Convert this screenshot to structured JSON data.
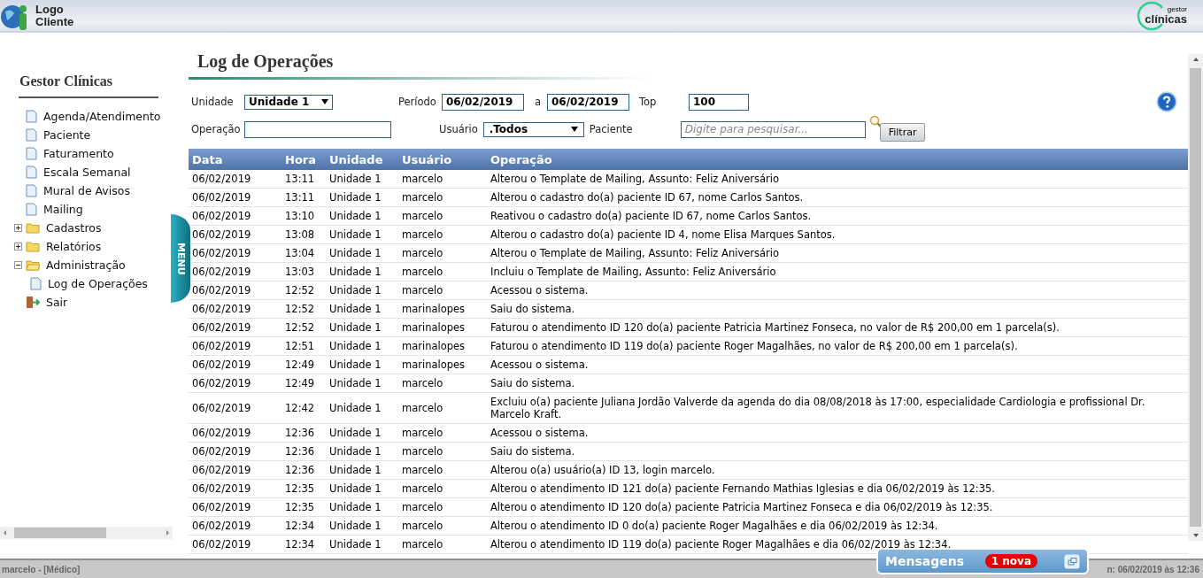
{
  "header": {
    "logo_text": [
      "Logo",
      "Cliente"
    ],
    "brand_small": "gestor",
    "brand": "clínicas"
  },
  "sidebar": {
    "title": "Gestor Clínicas",
    "items": [
      {
        "kind": "page",
        "label": "Agenda/Atendimento"
      },
      {
        "kind": "page",
        "label": "Paciente"
      },
      {
        "kind": "page",
        "label": "Faturamento"
      },
      {
        "kind": "page",
        "label": "Escala Semanal"
      },
      {
        "kind": "page",
        "label": "Mural de Avisos"
      },
      {
        "kind": "page",
        "label": "Mailing"
      },
      {
        "kind": "folder",
        "label": "Cadastros",
        "expanded": false
      },
      {
        "kind": "folder",
        "label": "Relatórios",
        "expanded": false
      },
      {
        "kind": "folder",
        "label": "Administração",
        "expanded": true,
        "children": [
          {
            "kind": "page",
            "label": "Log de Operações"
          }
        ]
      },
      {
        "kind": "exit",
        "label": "Sair"
      }
    ]
  },
  "menu_tab": "MENU",
  "page_title": "Log de Operações",
  "filters": {
    "unidade": {
      "label": "Unidade",
      "value": "Unidade 1"
    },
    "periodo": {
      "label": "Período",
      "from": "06/02/2019",
      "sep": "a",
      "to": "06/02/2019"
    },
    "top": {
      "label": "Top",
      "value": "100"
    },
    "operacao": {
      "label": "Operação"
    },
    "usuario": {
      "label": "Usuário",
      "value": ".Todos"
    },
    "paciente": {
      "label": "Paciente",
      "placeholder": "Digite para pesquisar..."
    },
    "button": "Filtrar"
  },
  "table": {
    "columns": [
      "Data",
      "Hora",
      "Unidade",
      "Usuário",
      "Operação"
    ],
    "rows": [
      [
        "06/02/2019",
        "13:11",
        "Unidade 1",
        "marcelo",
        "Alterou o Template de Mailing, Assunto: Feliz Aniversário"
      ],
      [
        "06/02/2019",
        "13:11",
        "Unidade 1",
        "marcelo",
        "Alterou o cadastro do(a) paciente ID 67, nome Carlos Santos."
      ],
      [
        "06/02/2019",
        "13:10",
        "Unidade 1",
        "marcelo",
        "Reativou o cadastro do(a) paciente ID 67, nome Carlos Santos."
      ],
      [
        "06/02/2019",
        "13:08",
        "Unidade 1",
        "marcelo",
        "Alterou o cadastro do(a) paciente ID 4, nome Elisa Marques Santos."
      ],
      [
        "06/02/2019",
        "13:04",
        "Unidade 1",
        "marcelo",
        "Alterou o Template de Mailing, Assunto: Feliz Aniversário"
      ],
      [
        "06/02/2019",
        "13:03",
        "Unidade 1",
        "marcelo",
        "Incluiu o Template de Mailing, Assunto: Feliz Aniversário"
      ],
      [
        "06/02/2019",
        "12:52",
        "Unidade 1",
        "marcelo",
        "Acessou o sistema."
      ],
      [
        "06/02/2019",
        "12:52",
        "Unidade 1",
        "marinalopes",
        "Saiu do sistema."
      ],
      [
        "06/02/2019",
        "12:52",
        "Unidade 1",
        "marinalopes",
        "Faturou o atendimento ID 120 do(a) paciente Patricia Martinez Fonseca, no valor de R$ 200,00 em 1 parcela(s)."
      ],
      [
        "06/02/2019",
        "12:51",
        "Unidade 1",
        "marinalopes",
        "Faturou o atendimento ID 119 do(a) paciente Roger Magalhães, no valor de R$ 200,00 em 1 parcela(s)."
      ],
      [
        "06/02/2019",
        "12:49",
        "Unidade 1",
        "marinalopes",
        "Acessou o sistema."
      ],
      [
        "06/02/2019",
        "12:49",
        "Unidade 1",
        "marcelo",
        "Saiu do sistema."
      ],
      [
        "06/02/2019",
        "12:42",
        "Unidade 1",
        "marcelo",
        "Excluiu o(a) paciente Juliana Jordão Valverde da agenda do dia 08/08/2018 às 17:00, especialidade Cardiologia e profissional Dr. Marcelo Kraft."
      ],
      [
        "06/02/2019",
        "12:36",
        "Unidade 1",
        "marcelo",
        "Acessou o sistema."
      ],
      [
        "06/02/2019",
        "12:36",
        "Unidade 1",
        "marcelo",
        "Saiu do sistema."
      ],
      [
        "06/02/2019",
        "12:36",
        "Unidade 1",
        "marcelo",
        "Alterou o(a) usuário(a) ID 13, login marcelo."
      ],
      [
        "06/02/2019",
        "12:35",
        "Unidade 1",
        "marcelo",
        "Alterou o atendimento ID 121 do(a) paciente Fernando Mathias Iglesias e dia 06/02/2019 às 12:35."
      ],
      [
        "06/02/2019",
        "12:35",
        "Unidade 1",
        "marcelo",
        "Alterou o atendimento ID 120 do(a) paciente Patricia Martinez Fonseca e dia 06/02/2019 às 12:35."
      ],
      [
        "06/02/2019",
        "12:34",
        "Unidade 1",
        "marcelo",
        "Alterou o atendimento ID 0 do(a) paciente Roger Magalhães e dia 06/02/2019 às 12:34."
      ],
      [
        "06/02/2019",
        "12:34",
        "Unidade 1",
        "marcelo",
        "Alterou o atendimento ID 119 do(a) paciente Roger Magalhães e dia 06/02/2019 às 12:34."
      ]
    ]
  },
  "status_bar": {
    "user": "marcelo - [Médico]",
    "login": "n: 06/02/2019  às 12:36"
  },
  "messages": {
    "title": "Mensagens",
    "badge": "1 nova"
  }
}
